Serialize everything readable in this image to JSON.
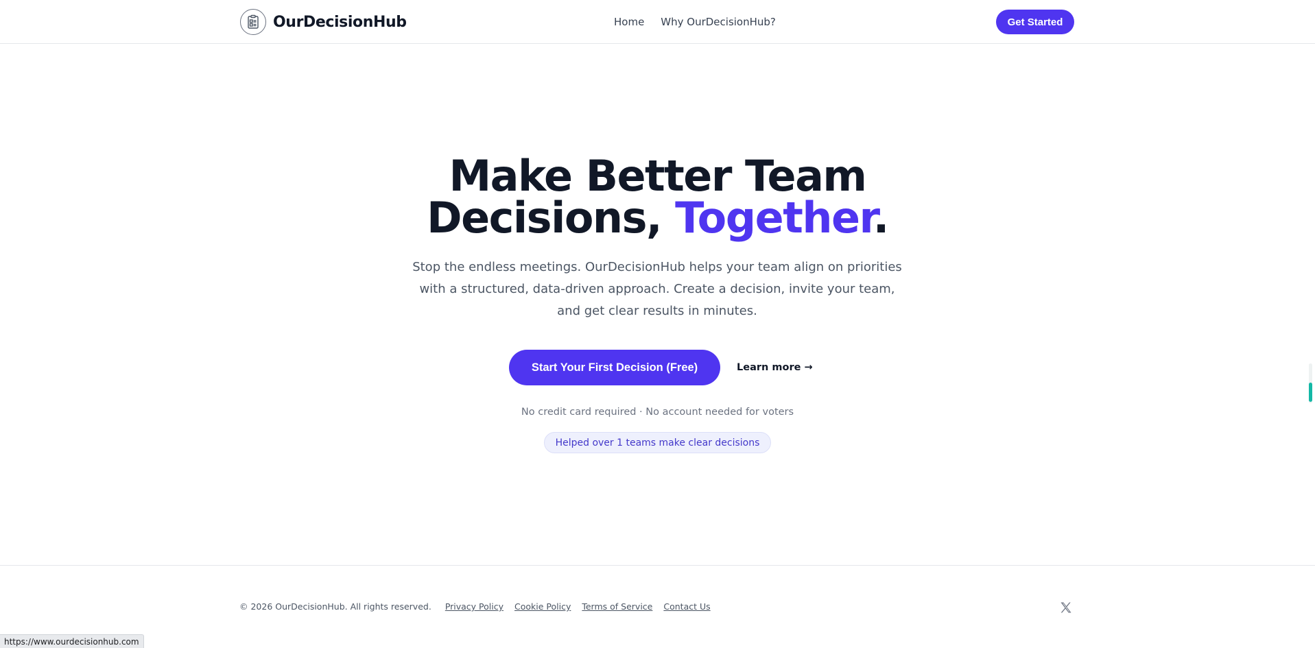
{
  "header": {
    "brand": "OurDecisionHub",
    "logo_icon": "clipboard-document-icon",
    "nav": [
      {
        "label": "Home"
      },
      {
        "label": "Why OurDecisionHub?"
      }
    ],
    "cta_label": "Get Started"
  },
  "hero": {
    "title_line1": "Make Better Team",
    "title_line2_prefix": "Decisions, ",
    "title_line2_accent": "Together",
    "title_line2_suffix": ".",
    "subtitle": "Stop the endless meetings. OurDecisionHub helps your team align on priorities with a structured, data-driven approach. Create a decision, invite your team, and get clear results in minutes.",
    "primary_cta": "Start Your First Decision (Free)",
    "secondary_cta": "Learn more →",
    "fine_print": "No credit card required · No account needed for voters",
    "badge": "Helped over 1 teams make clear decisions"
  },
  "footer": {
    "copyright": "© 2026 OurDecisionHub. All rights reserved.",
    "links": [
      {
        "label": "Privacy Policy"
      },
      {
        "label": "Cookie Policy"
      },
      {
        "label": "Terms of Service"
      },
      {
        "label": "Contact Us"
      }
    ],
    "social_icon": "x-twitter-icon"
  },
  "status_bar": {
    "url": "https://www.ourdecisionhub.com"
  },
  "colors": {
    "accent": "#4f35f0",
    "text_dark": "#111827",
    "text_muted": "#4b5563",
    "badge_bg": "#eef0fd",
    "scroll_thumb": "#14b8a6"
  }
}
